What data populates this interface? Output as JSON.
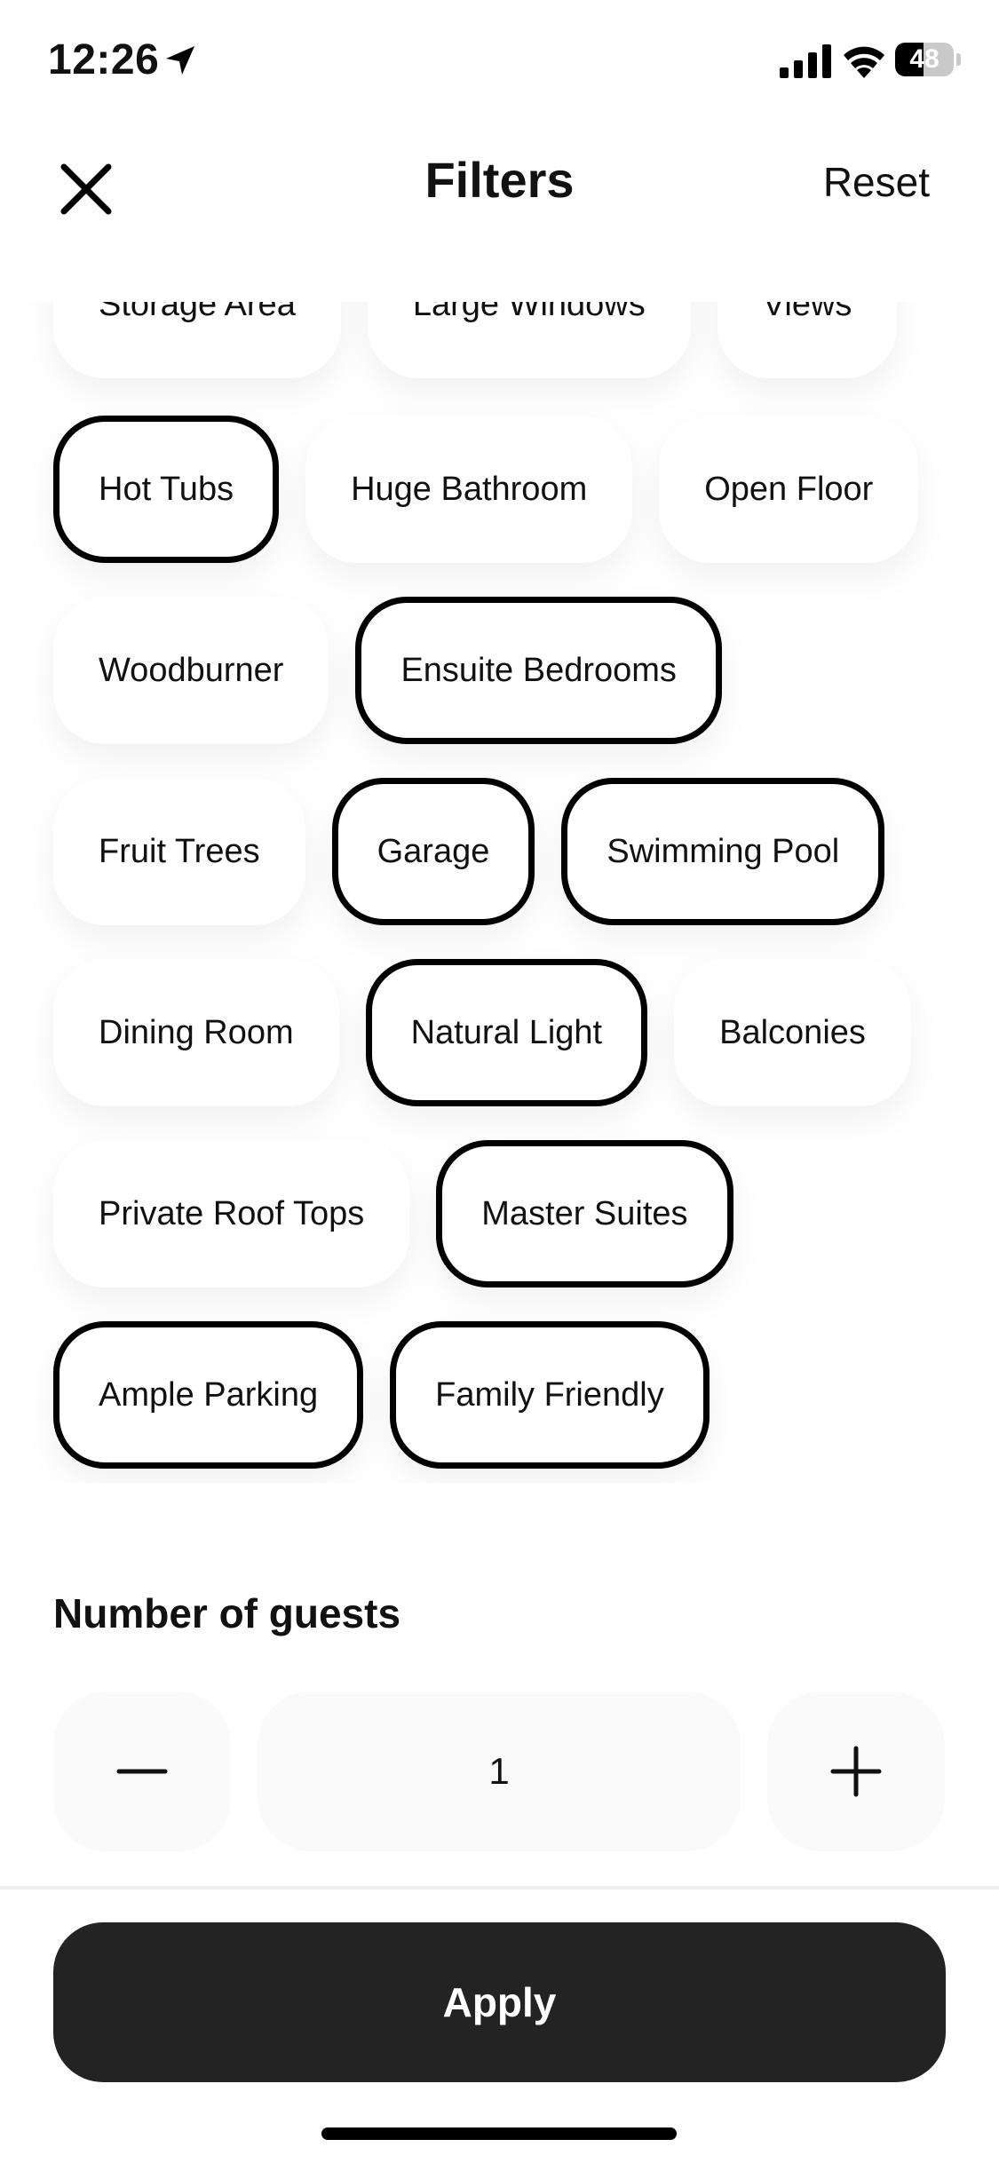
{
  "status_bar": {
    "time": "12:26",
    "battery_text": "48",
    "battery_level": 0.48
  },
  "header": {
    "title": "Filters",
    "reset_label": "Reset"
  },
  "amenities": {
    "rows": [
      [
        {
          "label": "Storage Area",
          "selected": false
        },
        {
          "label": "Large Windows",
          "selected": false
        },
        {
          "label": "Views",
          "selected": false
        }
      ],
      [
        {
          "label": "Hot Tubs",
          "selected": true
        },
        {
          "label": "Huge Bathroom",
          "selected": false
        },
        {
          "label": "Open Floor",
          "selected": false
        }
      ],
      [
        {
          "label": "Woodburner",
          "selected": false
        },
        {
          "label": "Ensuite Bedrooms",
          "selected": true
        }
      ],
      [
        {
          "label": "Fruit Trees",
          "selected": false
        },
        {
          "label": "Garage",
          "selected": true
        },
        {
          "label": "Swimming Pool",
          "selected": true
        }
      ],
      [
        {
          "label": "Dining Room",
          "selected": false
        },
        {
          "label": "Natural Light",
          "selected": true
        },
        {
          "label": "Balconies",
          "selected": false
        }
      ],
      [
        {
          "label": "Private Roof Tops",
          "selected": false
        },
        {
          "label": "Master Suites",
          "selected": true
        }
      ],
      [
        {
          "label": "Ample Parking",
          "selected": true
        },
        {
          "label": "Family Friendly",
          "selected": true
        }
      ]
    ]
  },
  "guests": {
    "title": "Number of guests",
    "value": "1"
  },
  "apply_label": "Apply",
  "colors": {
    "selected_border": "#000000",
    "apply_background": "#232323",
    "stepper_background": "#fafafa"
  }
}
